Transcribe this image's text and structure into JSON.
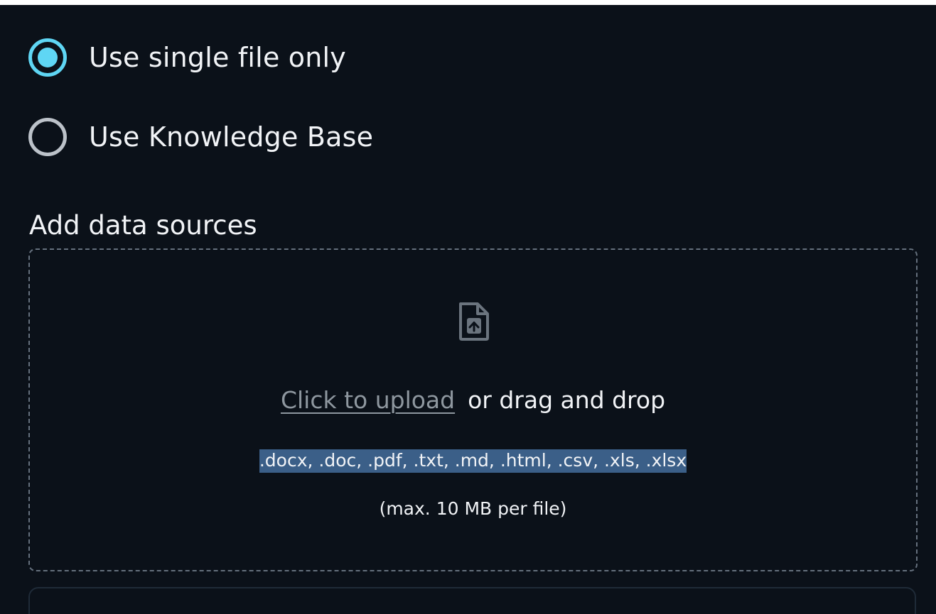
{
  "mode_options": [
    {
      "label": "Use single file only",
      "selected": true
    },
    {
      "label": "Use Knowledge Base",
      "selected": false
    }
  ],
  "data_sources": {
    "title": "Add data sources",
    "upload_icon": "file-upload-icon",
    "upload_link": "Click to upload",
    "drag_text": "or drag and drop",
    "accepted_formats": ".docx, .doc, .pdf, .txt, .md, .html, .csv, .xls, .xlsx",
    "size_limit": "(max. 10 MB per file)"
  },
  "colors": {
    "background": "#0b1119",
    "accent": "#5fd6f4",
    "text": "#f1f3f6",
    "link": "#8e979f",
    "selection": "#3b5f88",
    "dashed_border": "#65707d"
  }
}
